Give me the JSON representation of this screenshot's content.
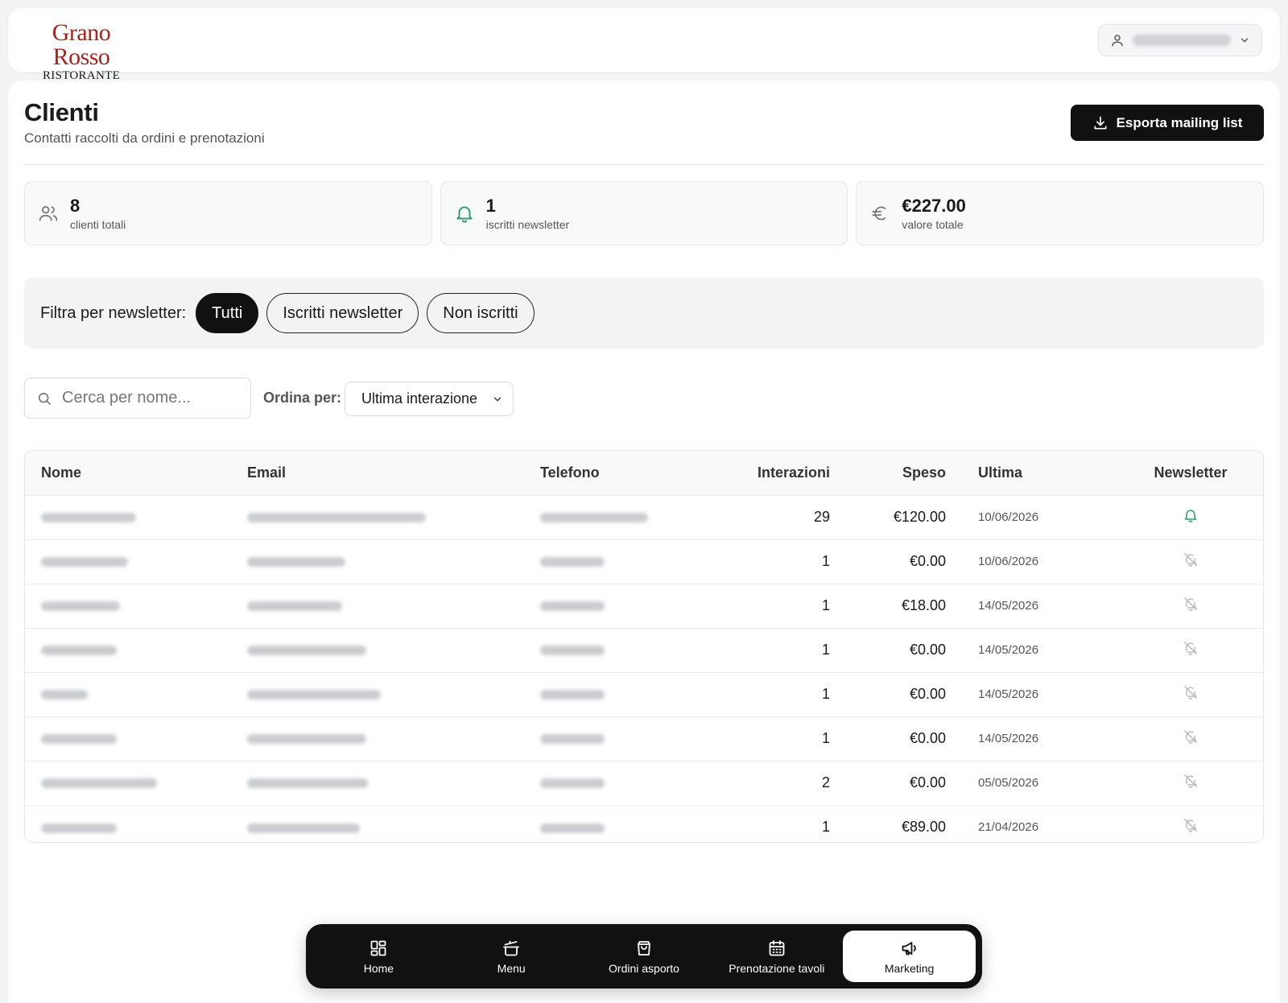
{
  "header": {
    "logo_main": "Grano Rosso",
    "logo_sub": "RISTORANTE",
    "user_icon": "user-icon",
    "dropdown_icon": "chevron-down-icon"
  },
  "page": {
    "title": "Clienti",
    "subtitle": "Contatti raccolti da ordini e prenotazioni",
    "export_label": "Esporta mailing list",
    "export_icon": "download-icon"
  },
  "stats": [
    {
      "icon": "users-icon",
      "value": "8",
      "label": "clienti totali"
    },
    {
      "icon": "bell-icon",
      "value": "1",
      "label": "iscritti newsletter"
    },
    {
      "icon": "euro-icon",
      "value": "€227.00",
      "label": "valore totale"
    }
  ],
  "filter": {
    "label": "Filtra per newsletter:",
    "options": [
      "Tutti",
      "Iscritti newsletter",
      "Non iscritti"
    ],
    "selected": "Tutti"
  },
  "search": {
    "placeholder": "Cerca per nome...",
    "icon": "search-icon"
  },
  "sort": {
    "label": "Ordina per:",
    "selected": "Ultima interazione"
  },
  "table": {
    "columns": [
      "Nome",
      "Email",
      "Telefono",
      "Interazioni",
      "Speso",
      "Ultima",
      "Newsletter"
    ],
    "rows": [
      {
        "interazioni": "29",
        "speso": "€120.00",
        "ultima": "10/06/2026",
        "newsletter": true
      },
      {
        "interazioni": "1",
        "speso": "€0.00",
        "ultima": "10/06/2026",
        "newsletter": false
      },
      {
        "interazioni": "1",
        "speso": "€18.00",
        "ultima": "14/05/2026",
        "newsletter": false
      },
      {
        "interazioni": "1",
        "speso": "€0.00",
        "ultima": "14/05/2026",
        "newsletter": false
      },
      {
        "interazioni": "1",
        "speso": "€0.00",
        "ultima": "14/05/2026",
        "newsletter": false
      },
      {
        "interazioni": "1",
        "speso": "€0.00",
        "ultima": "14/05/2026",
        "newsletter": false
      },
      {
        "interazioni": "2",
        "speso": "€0.00",
        "ultima": "05/05/2026",
        "newsletter": false
      },
      {
        "interazioni": "1",
        "speso": "€89.00",
        "ultima": "21/04/2026",
        "newsletter": false
      }
    ]
  },
  "nav": {
    "items": [
      {
        "label": "Home",
        "icon": "grid-icon"
      },
      {
        "label": "Menu",
        "icon": "pot-icon"
      },
      {
        "label": "Ordini asporto",
        "icon": "bag-icon"
      },
      {
        "label": "Prenotazione tavoli",
        "icon": "calendar-icon"
      },
      {
        "label": "Marketing",
        "icon": "megaphone-icon"
      }
    ],
    "active": "Marketing"
  },
  "colors": {
    "brand_red": "#a8241c",
    "accent_green": "#2f9e6e",
    "primary_dark": "#111111"
  }
}
